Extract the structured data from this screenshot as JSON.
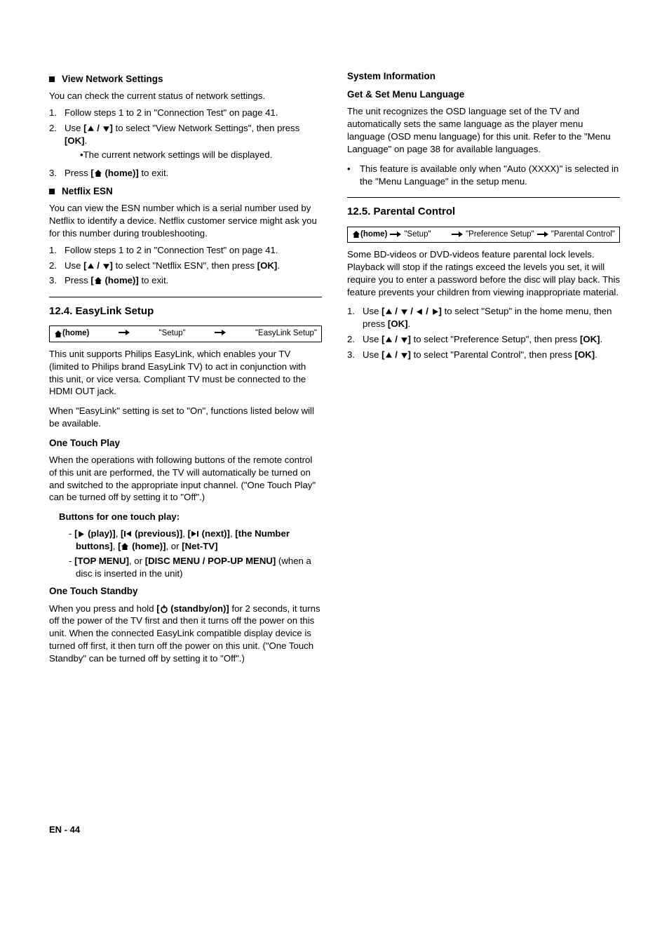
{
  "left": {
    "view_network": {
      "heading": "View Network Settings",
      "intro": "You can check the current status of network settings.",
      "steps": [
        "Follow steps 1 to 2 in \"Connection Test\" on page 41.",
        "Use [▲ / ▼] to select \"View Network Settings\", then press [OK].",
        "Press [⌂ (home)] to exit."
      ],
      "sub_current": "The current network settings will be displayed."
    },
    "netflix": {
      "heading": "Netflix ESN",
      "intro": "You can view the ESN number which is a serial number used by Netflix to identify a device. Netflix customer service might ask you for this number during troubleshooting.",
      "steps": [
        "Follow steps 1 to 2 in \"Connection Test\" on page 41.",
        "Use [▲ / ▼] to select \"Netflix ESN\", then press [OK].",
        "Press [⌂ (home)] to exit."
      ]
    },
    "easylink": {
      "sec_title": "12.4. EasyLink Setup",
      "nav": {
        "home": "(home)",
        "setup": "\"Setup\"",
        "target": "\"EasyLink Setup\""
      },
      "p1": "This unit supports Philips EasyLink, which enables your TV (limited to Philips brand EasyLink TV) to act in conjunction with this unit, or vice versa. Compliant TV must be connected to the HDMI OUT jack.",
      "p2": "When \"EasyLink\" setting is set to \"On\", functions listed below will be available.",
      "otp_heading": "One Touch Play",
      "otp_body": "When the operations with following buttons of the remote control of this unit are performed, the TV will automatically be turned on and switched to the appropriate input channel. (\"One Touch Play\" can be turned off by setting it to \"Off\".)",
      "buttons_heading": "Buttons for one touch play:",
      "buttons_item1a": "[▶ (play)]",
      "buttons_item1b": "[▐◀ (previous)]",
      "buttons_item1c": "[▶▌ (next)]",
      "buttons_item1d": "[the Number buttons]",
      "buttons_item1e": "[⌂ (home)]",
      "buttons_item1f": "[Net-TV]",
      "buttons_item2a": "[TOP MENU]",
      "buttons_item2b": "[DISC MENU / POP-UP MENU]",
      "buttons_item2_tail": "(when a disc is inserted in the unit)",
      "ots_heading": "One Touch Standby",
      "ots_body_pre": "When you press and hold ",
      "ots_body_btn": "[⏻ (standby/on)]",
      "ots_body_post": " for 2 seconds, it turns off the power of the TV first and then it turns off the power on this unit. When the connected EasyLink compatible display device is turned off first, it then turn off the power on this unit. (\"One Touch Standby\" can be turned off by setting it to \"Off\".)"
    }
  },
  "right": {
    "sysinfo_heading": "System Information",
    "getset_heading": "Get & Set Menu Language",
    "getset_body": "The unit recognizes the OSD language set of the TV and automatically sets the same language as the player menu language (OSD menu language) for this unit. Refer to the \"Menu Language\" on page 38 for available languages.",
    "getset_bullet": "This feature is available only when \"Auto (XXXX)\" is selected in the \"Menu Language\" in the setup menu.",
    "parental": {
      "sec_title": "12.5. Parental Control",
      "nav": {
        "home": "(home)",
        "setup": "\"Setup\"",
        "pref": "\"Preference Setup\"",
        "target": "\"Parental Control\""
      },
      "body": "Some BD-videos or DVD-videos feature parental lock levels. Playback will stop if the ratings exceed the levels you set, it will require you to enter a password before the disc will play back. This feature prevents your children from viewing inappropriate material.",
      "steps": [
        "Use [▲ / ▼ / ◀ / ▶] to select \"Setup\" in the home menu, then press [OK].",
        "Use [▲ / ▼] to select \"Preference Setup\", then press [OK].",
        "Use [▲ / ▼] to select \"Parental Control\", then press [OK]."
      ]
    }
  },
  "footer": "EN - 44"
}
